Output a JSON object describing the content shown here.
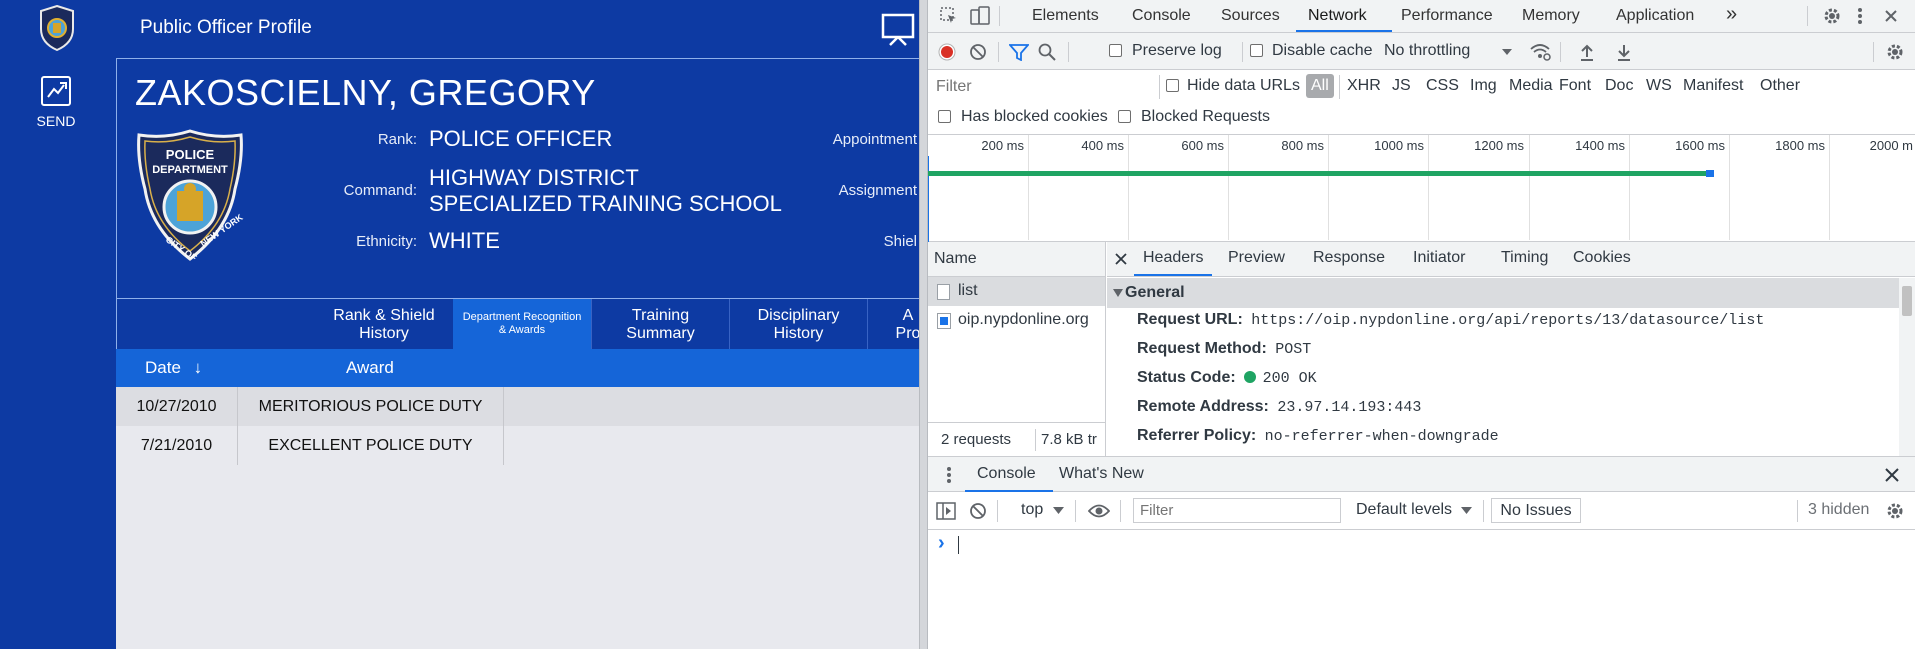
{
  "app": {
    "title": "Public Officer Profile",
    "send_label": "SEND",
    "officer_name": "ZAKOSCIELNY, GREGORY",
    "fields": {
      "rank_label": "Rank:",
      "rank_value": "POLICE OFFICER",
      "command_label": "Command:",
      "command_line1": "HIGHWAY DISTRICT",
      "command_line2": "SPECIALIZED TRAINING SCHOOL",
      "ethnicity_label": "Ethnicity:",
      "ethnicity_value": "WHITE",
      "appointment_label": "Appointment",
      "assignment_label": "Assignment",
      "shield_label": "Shiel"
    },
    "tabs": [
      {
        "line1": "Rank & Shield",
        "line2": "History"
      },
      {
        "line1": "Department Recognition",
        "line2": "& Awards"
      },
      {
        "line1": "Training",
        "line2": "Summary"
      },
      {
        "line1": "Disciplinary",
        "line2": "History"
      },
      {
        "line1": "A",
        "line2": "Pro"
      }
    ],
    "table": {
      "col_date": "Date",
      "sort_arrow": "↓",
      "col_award": "Award",
      "rows": [
        {
          "date": "10/27/2010",
          "award": "MERITORIOUS POLICE DUTY"
        },
        {
          "date": "7/21/2010",
          "award": "EXCELLENT POLICE DUTY"
        }
      ]
    }
  },
  "devtools": {
    "tabs": [
      "Elements",
      "Console",
      "Sources",
      "Network",
      "Performance",
      "Memory",
      "Application"
    ],
    "active_tab": "Network",
    "more_tabs": "»",
    "toolbar": {
      "preserve_log": "Preserve log",
      "disable_cache": "Disable cache",
      "throttling": "No throttling"
    },
    "filter_placeholder": "Filter",
    "hide_data_urls": "Hide data URLs",
    "type_filters": [
      "All",
      "XHR",
      "JS",
      "CSS",
      "Img",
      "Media",
      "Font",
      "Doc",
      "WS",
      "Manifest",
      "Other"
    ],
    "has_blocked_cookies": "Has blocked cookies",
    "blocked_requests": "Blocked Requests",
    "timeline_ticks": [
      "200 ms",
      "400 ms",
      "600 ms",
      "800 ms",
      "1000 ms",
      "1200 ms",
      "1400 ms",
      "1600 ms",
      "1800 ms",
      "2000 m"
    ],
    "name_header": "Name",
    "requests": [
      {
        "name": "list"
      },
      {
        "name": "oip.nypdonline.org"
      }
    ],
    "summary_requests": "2 requests",
    "summary_transferred": "7.8 kB tr",
    "detail_tabs": [
      "Headers",
      "Preview",
      "Response",
      "Initiator",
      "Timing",
      "Cookies"
    ],
    "general_title": "General",
    "headers": [
      {
        "key": "Request URL:",
        "value": "https://oip.nypdonline.org/api/reports/13/datasource/list"
      },
      {
        "key": "Request Method:",
        "value": "POST"
      },
      {
        "key": "Status Code:",
        "value": "200 OK"
      },
      {
        "key": "Remote Address:",
        "value": "23.97.14.193:443"
      },
      {
        "key": "Referrer Policy:",
        "value": "no-referrer-when-downgrade"
      }
    ],
    "drawer_tabs": [
      "Console",
      "What's New"
    ],
    "console": {
      "context": "top",
      "filter_placeholder": "Filter",
      "levels": "Default levels",
      "issues": "No Issues",
      "hidden": "3 hidden",
      "prompt": "›"
    },
    "colors": {
      "accent": "#1a73e8",
      "record": "#d93025",
      "waterfall": "#1fa463"
    }
  }
}
